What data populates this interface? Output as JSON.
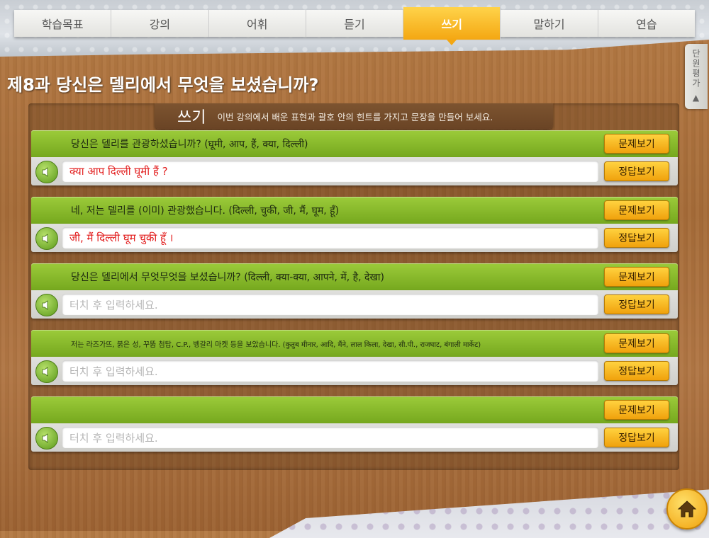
{
  "tabs": [
    {
      "label": "학습목표",
      "active": false
    },
    {
      "label": "강의",
      "active": false
    },
    {
      "label": "어휘",
      "active": false
    },
    {
      "label": "듣기",
      "active": false
    },
    {
      "label": "쓰기",
      "active": true
    },
    {
      "label": "말하기",
      "active": false
    },
    {
      "label": "연습",
      "active": false
    }
  ],
  "side_tab": {
    "label": "단원평가 ▲"
  },
  "page_title": "제8과 당신은 델리에서 무엇을 보셨습니까?",
  "section": {
    "title": "쓰기",
    "description": "이번 강의에서 배운 표현과 괄호 안의 힌트를 가지고 문장을 만들어 보세요."
  },
  "buttons": {
    "question": "문제보기",
    "answer": "정답보기"
  },
  "placeholder": "터치 후 입력하세요.",
  "items": [
    {
      "question": "당신은 델리를 관광하셨습니까? (घूमी, आप, हैं, क्या, दिल्ली)",
      "answer": "क्या आप दिल्ली घूमी हैं ?"
    },
    {
      "question": "네, 저는 델리를 (이미) 관광했습니다. (दिल्ली, चुकी, जी, मैं, घूम, हूँ)",
      "answer": "जी, मैं दिल्ली घूम चुकी हूँ ।"
    },
    {
      "question": "당신은 델리에서 무엇무엇을 보셨습니까? (दिल्ली, क्या-क्या, आपने, में, है, देखा)",
      "answer": ""
    },
    {
      "question": "저는 라즈가뜨, 붉은 성, 꾸뚭 첨탑, C.P., 벵갈리 마켓 등을 보았습니다. (कुतुब मीनार, आदि, मैंने, लाल किला, देखा, सी.पी., राजघाट, बंगाली मार्केट)",
      "answer": ""
    },
    {
      "question": "",
      "answer": ""
    }
  ],
  "icons": {
    "speaker": "speaker-icon",
    "home": "home-icon"
  },
  "colors": {
    "accent": "#f4a712",
    "question_bar": "#8cbf2e",
    "answer_text": "#e21c1c"
  }
}
